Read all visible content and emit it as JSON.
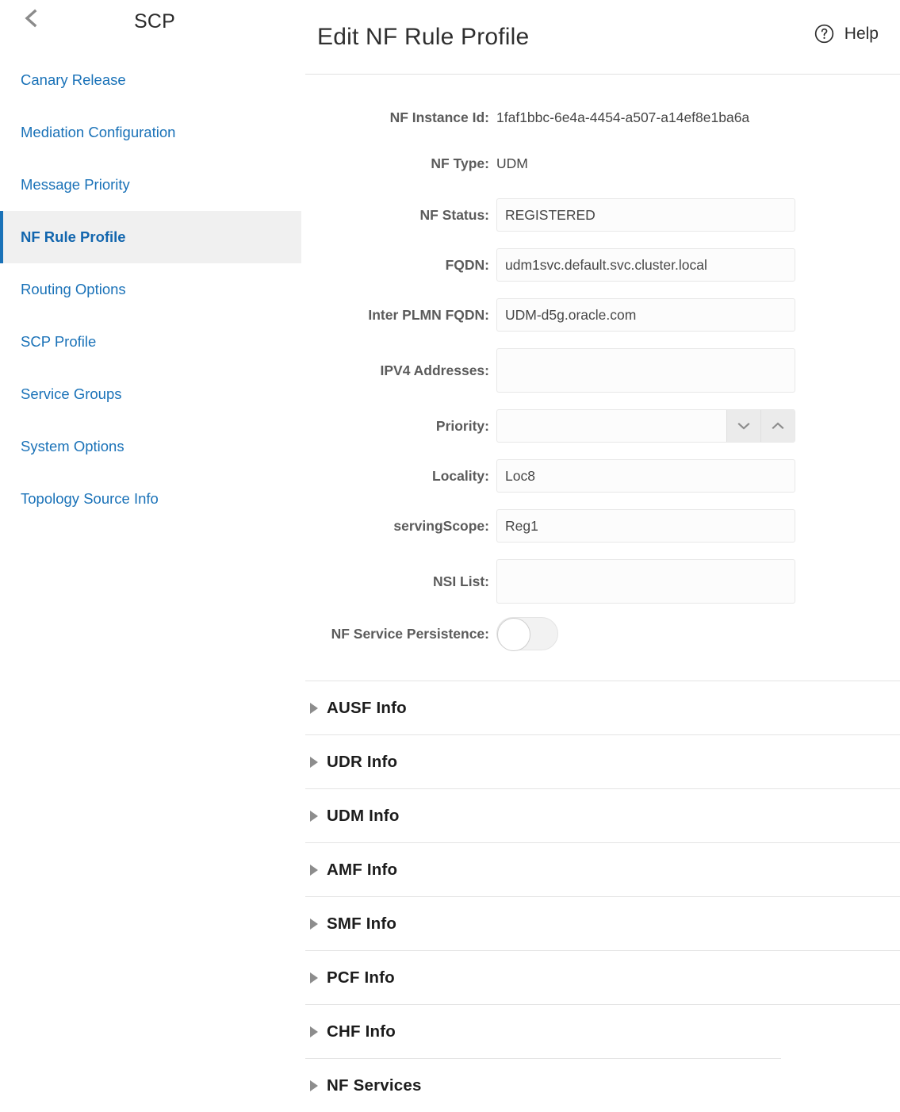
{
  "sidebar": {
    "title": "SCP",
    "back_icon": "chevron-left-icon",
    "items": [
      {
        "label": "Canary Release",
        "active": false
      },
      {
        "label": "Mediation Configuration",
        "active": false
      },
      {
        "label": "Message Priority",
        "active": false
      },
      {
        "label": "NF Rule Profile",
        "active": true
      },
      {
        "label": "Routing Options",
        "active": false
      },
      {
        "label": "SCP Profile",
        "active": false
      },
      {
        "label": "Service Groups",
        "active": false
      },
      {
        "label": "System Options",
        "active": false
      },
      {
        "label": "Topology Source Info",
        "active": false
      }
    ]
  },
  "header": {
    "title": "Edit NF Rule Profile",
    "help_label": "Help",
    "help_icon": "question-circle-icon"
  },
  "form": {
    "nf_instance_id": {
      "label": "NF Instance Id:",
      "value": "1faf1bbc-6e4a-4454-a507-a14ef8e1ba6a",
      "type": "static"
    },
    "nf_type": {
      "label": "NF Type:",
      "value": "UDM",
      "type": "static"
    },
    "nf_status": {
      "label": "NF Status:",
      "value": "REGISTERED",
      "type": "input"
    },
    "fqdn": {
      "label": "FQDN:",
      "value": "udm1svc.default.svc.cluster.local",
      "type": "input"
    },
    "inter_plmn_fqdn": {
      "label": "Inter PLMN FQDN:",
      "value": "UDM-d5g.oracle.com",
      "type": "input"
    },
    "ipv4_addresses": {
      "label": "IPV4 Addresses:",
      "value": "",
      "type": "textarea"
    },
    "priority": {
      "label": "Priority:",
      "value": "",
      "type": "spinner",
      "down_icon": "chevron-down-icon",
      "up_icon": "chevron-up-icon"
    },
    "locality": {
      "label": "Locality:",
      "value": "Loc8",
      "type": "input"
    },
    "serving_scope": {
      "label": "servingScope:",
      "value": "Reg1",
      "type": "input"
    },
    "nsi_list": {
      "label": "NSI List:",
      "value": "",
      "type": "textarea"
    },
    "nf_service_persistence": {
      "label": "NF Service Persistence:",
      "value": "off",
      "type": "toggle"
    }
  },
  "accordions": [
    {
      "label": "AUSF Info",
      "expanded": false,
      "divider": "full"
    },
    {
      "label": "UDR Info",
      "expanded": false,
      "divider": "full"
    },
    {
      "label": "UDM Info",
      "expanded": false,
      "divider": "full"
    },
    {
      "label": "AMF Info",
      "expanded": false,
      "divider": "full"
    },
    {
      "label": "SMF Info",
      "expanded": false,
      "divider": "full"
    },
    {
      "label": "PCF Info",
      "expanded": false,
      "divider": "full"
    },
    {
      "label": "CHF Info",
      "expanded": false,
      "divider": "full"
    },
    {
      "label": "NF Services",
      "expanded": false,
      "divider": "short"
    }
  ],
  "colors": {
    "accent_blue": "#1a72b8",
    "active_bg": "#f0f0f0",
    "label_gray": "#5b5b5b",
    "divider": "#e4e4e4",
    "field_bg": "#fcfcfc"
  }
}
